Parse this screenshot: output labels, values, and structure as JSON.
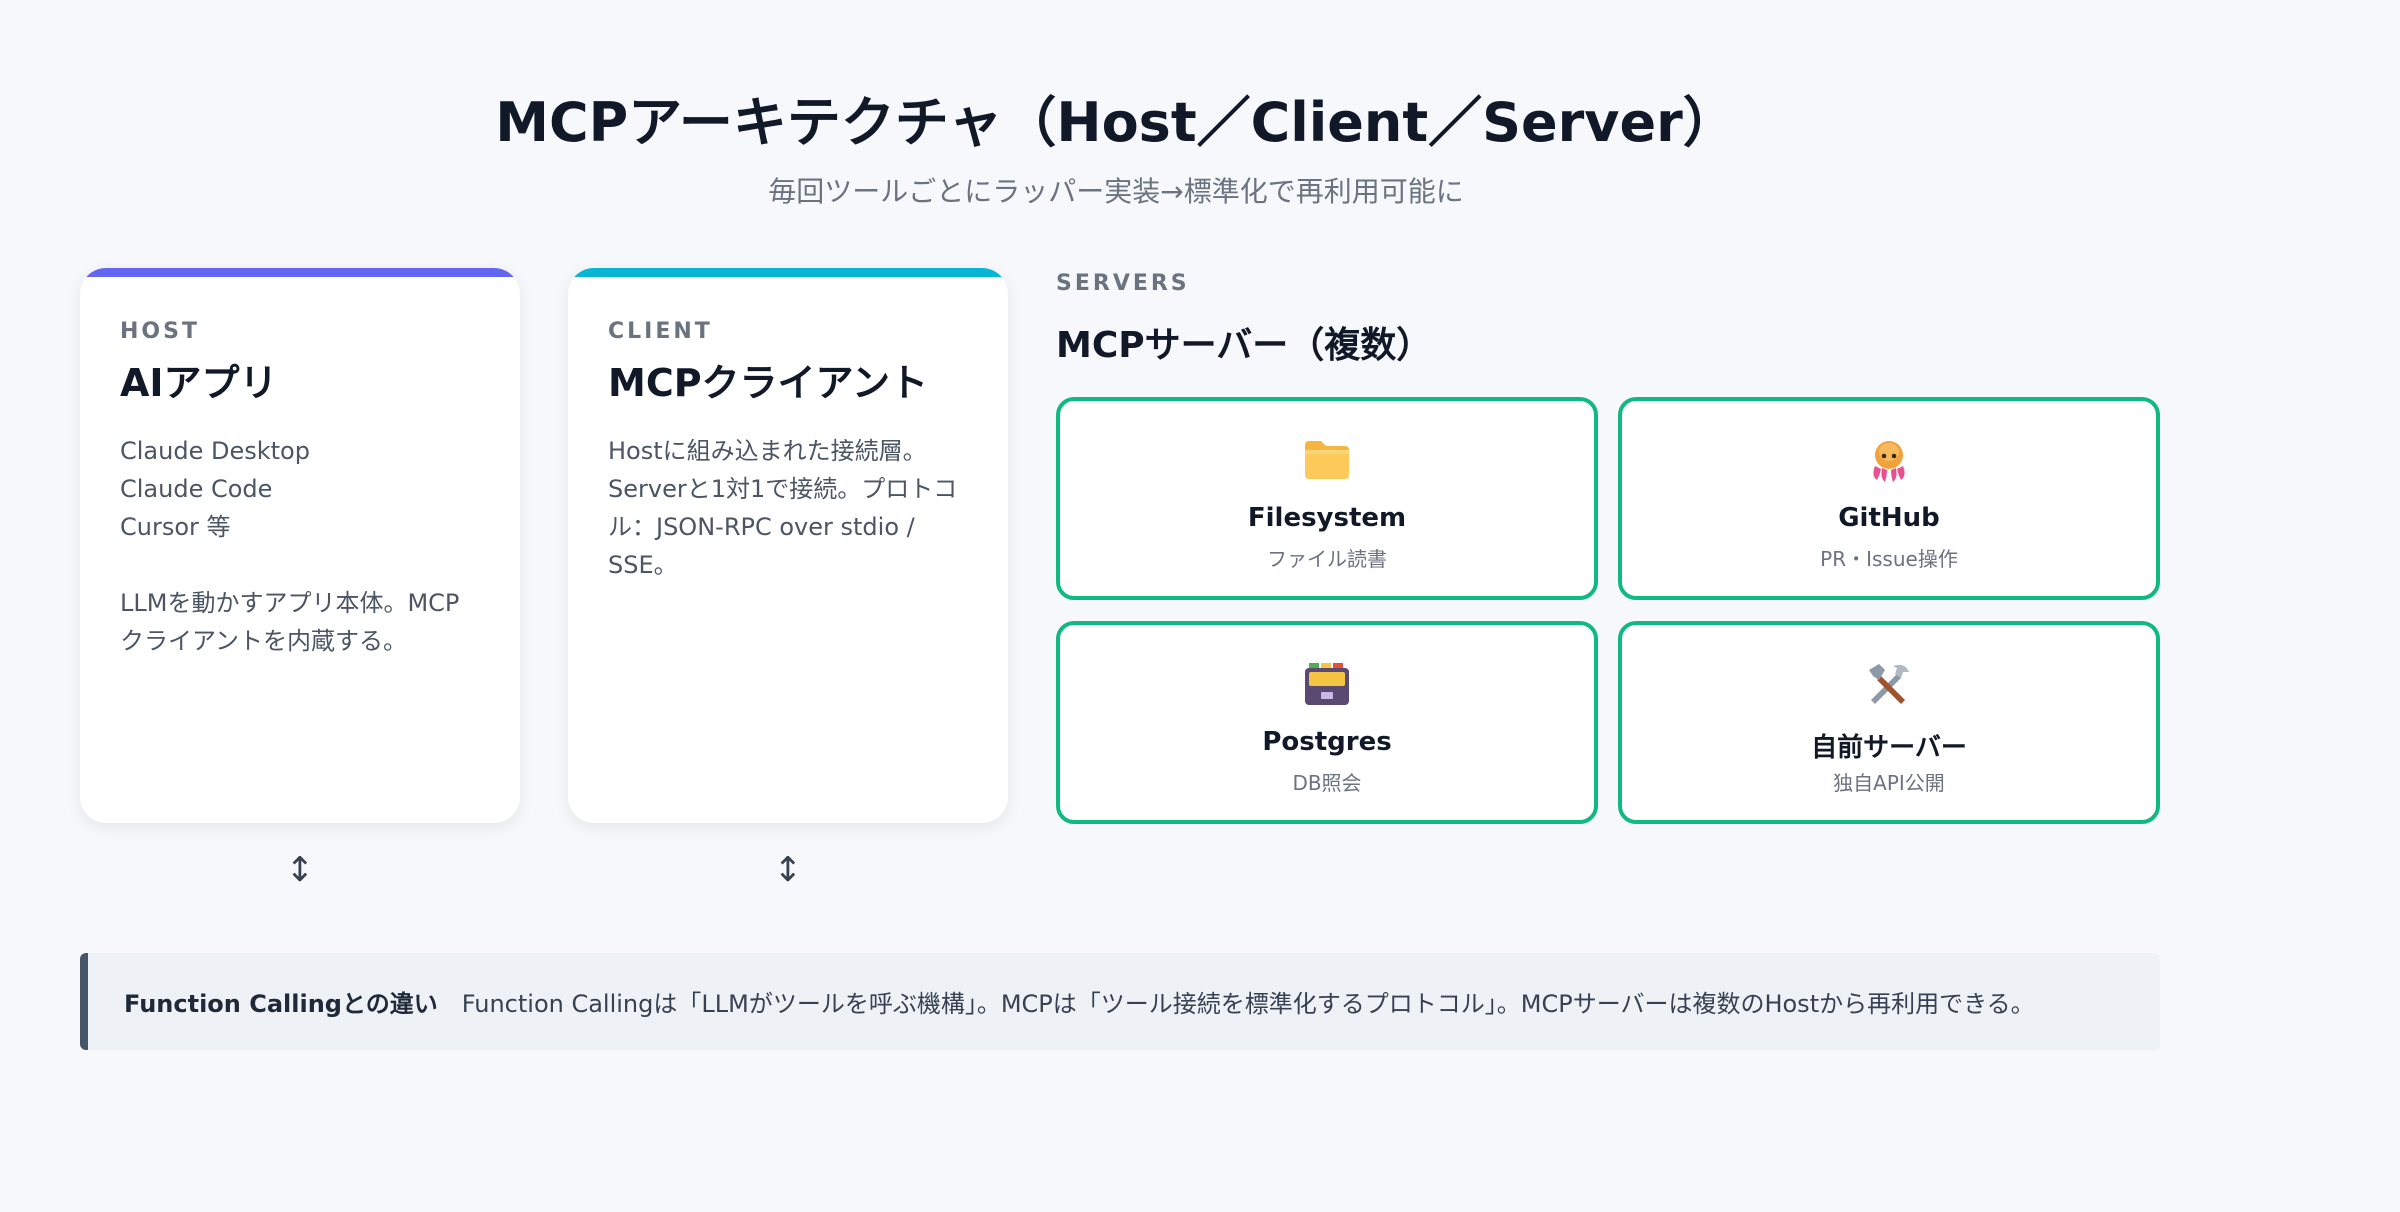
{
  "title": "MCPアーキテクチャ（Host／Client／Server）",
  "subtitle": "毎回ツールごとにラッパー実装→標準化で再利用可能に",
  "host": {
    "label": "HOST",
    "title": "AIアプリ",
    "body": "Claude Desktop\nClaude Code\nCursor 等\n\nLLMを動かすアプリ本体。MCP\nクライアントを内蔵する。",
    "accent": "#6366f1"
  },
  "client": {
    "label": "CLIENT",
    "title": "MCPクライアント",
    "body": "Hostに組み込まれた接続層。\nServerと1対1で接続。プロトコ\nル：JSON-RPC over stdio /\nSSE。",
    "accent": "#06b6d4"
  },
  "arrows": {
    "host": "↕",
    "client": "↕"
  },
  "servers": {
    "label": "SERVERS",
    "title": "MCPサーバー（複数）",
    "border_color": "#10b981",
    "items": [
      {
        "icon": "folder-icon",
        "name": "Filesystem",
        "desc": "ファイル読書"
      },
      {
        "icon": "octopus-icon",
        "name": "GitHub",
        "desc": "PR・Issue操作"
      },
      {
        "icon": "database-cabinet-icon",
        "name": "Postgres",
        "desc": "DB照会"
      },
      {
        "icon": "tools-icon",
        "name": "自前サーバー",
        "desc": "独自API公開"
      }
    ]
  },
  "note": {
    "heading": "Function Callingとの違い",
    "text": "Function Callingは「LLMがツールを呼ぶ機構」。MCPは「ツール接続を標準化するプロトコル」。MCPサーバーは複数のHostから再利用できる。"
  }
}
